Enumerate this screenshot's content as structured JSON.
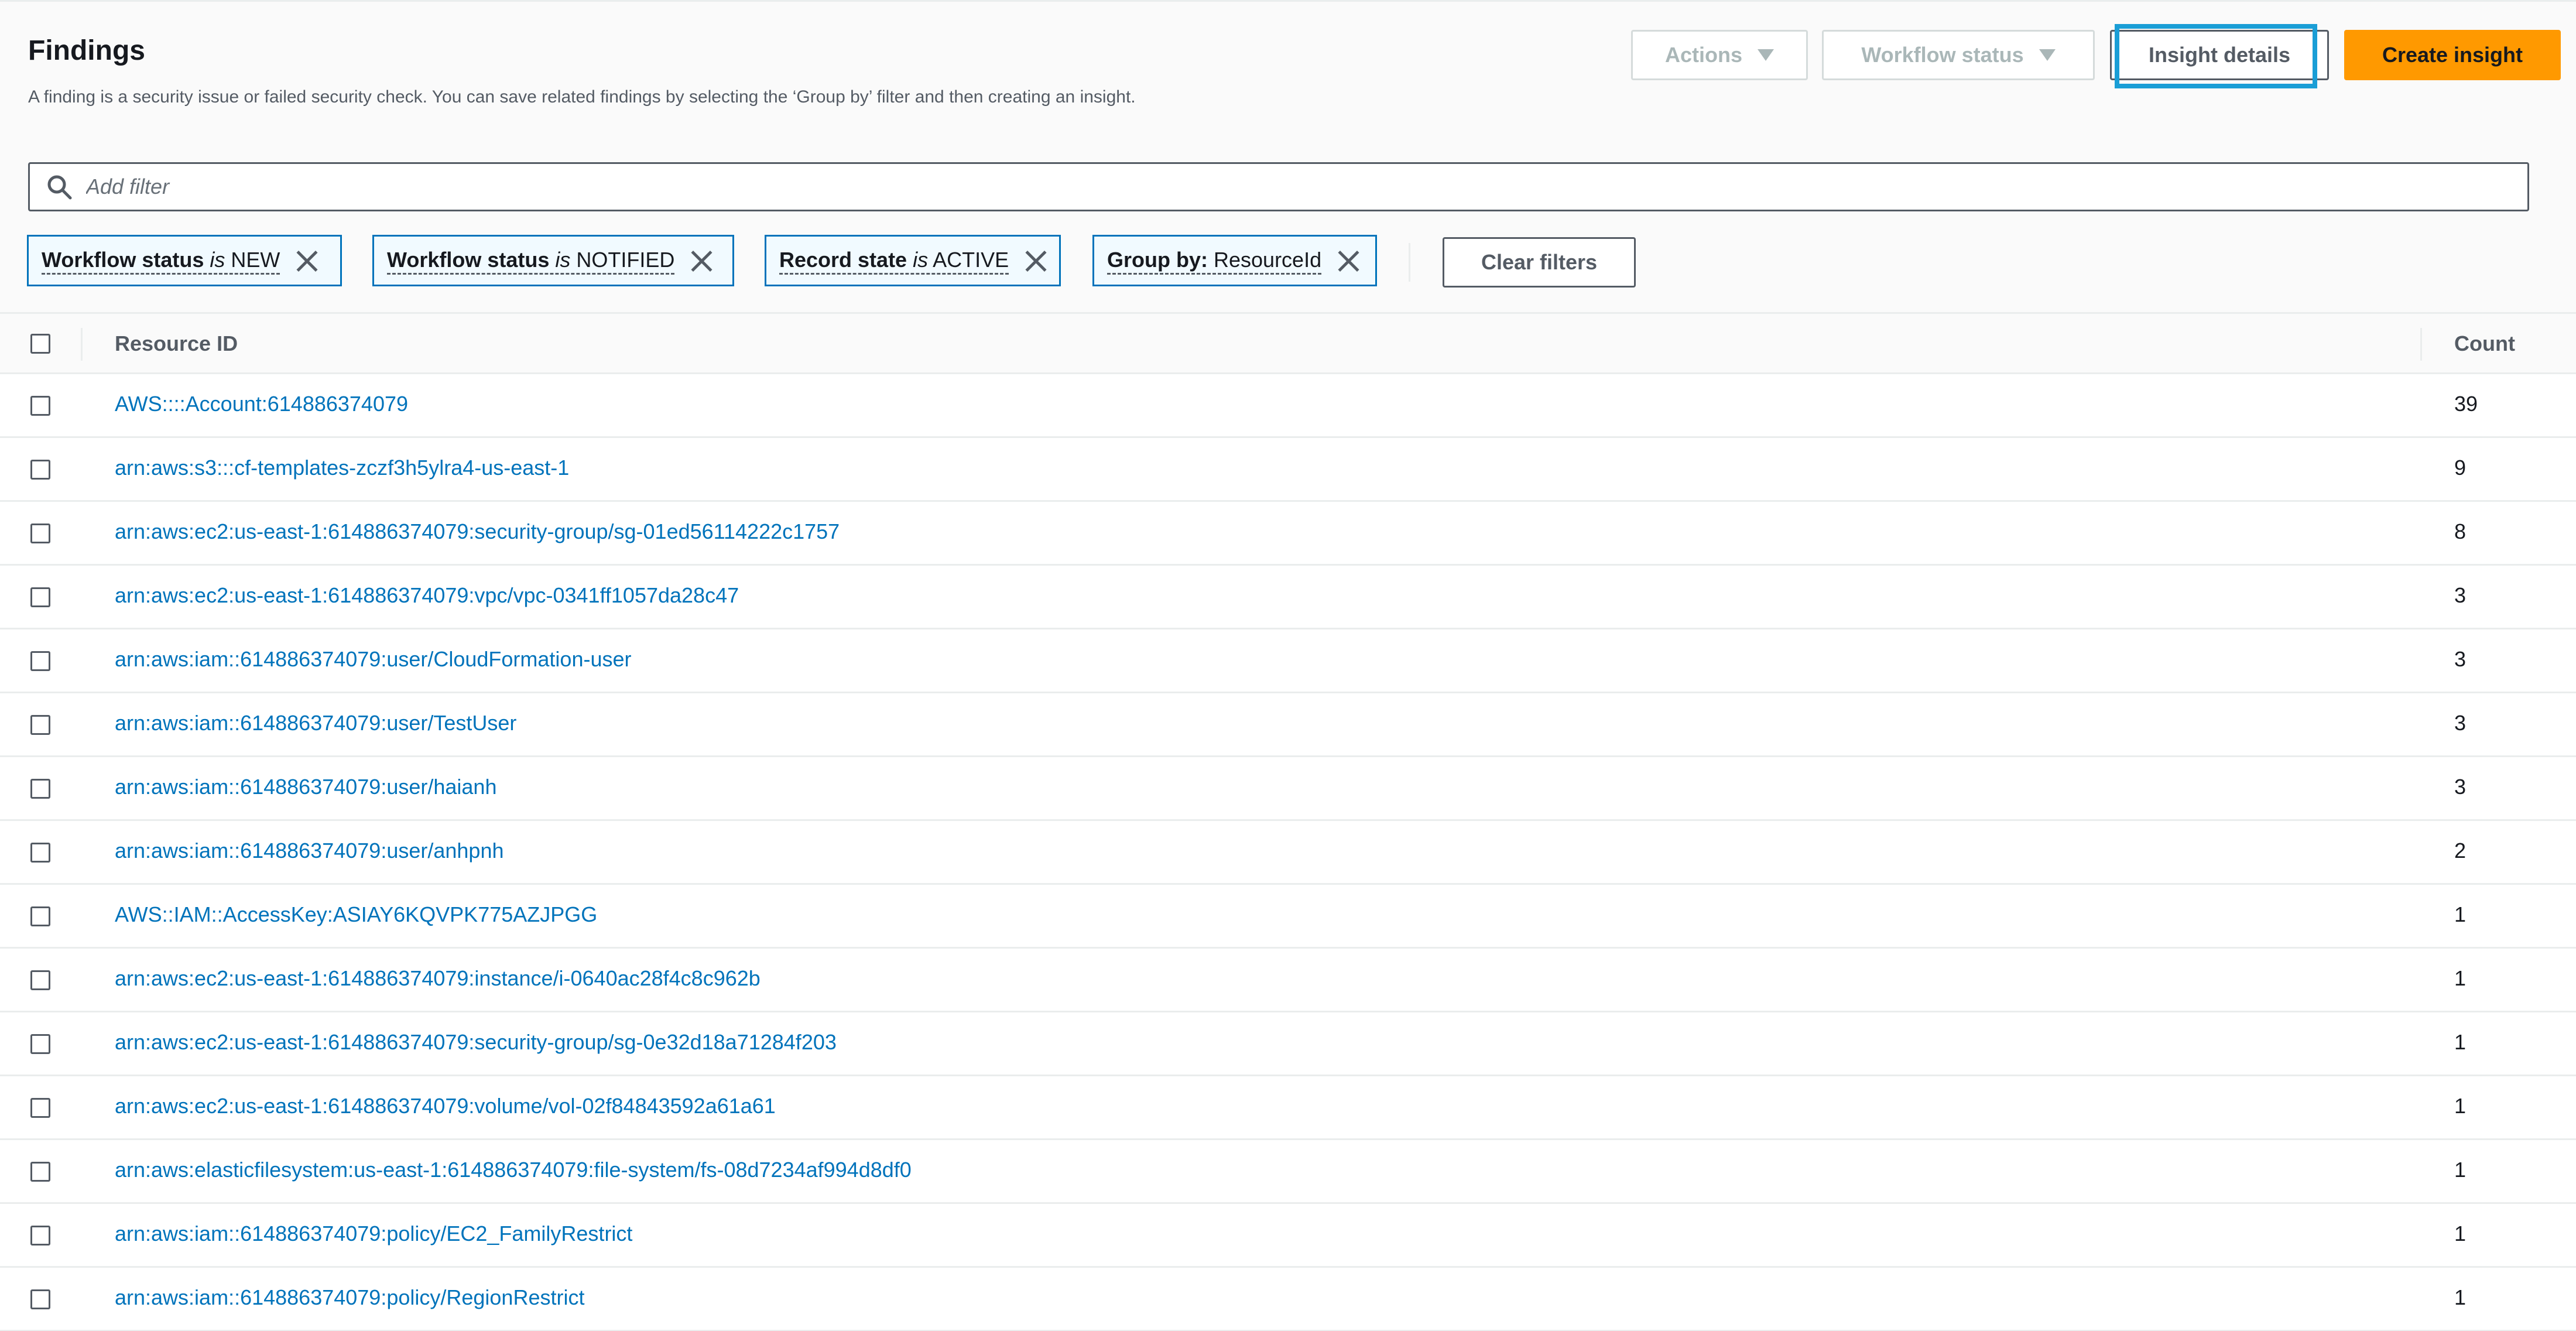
{
  "header": {
    "title": "Findings",
    "description": "A finding is a security issue or failed security check. You can save related findings by selecting the ‘Group by’ filter and then creating an insight."
  },
  "toolbar": {
    "actions_label": "Actions",
    "workflow_status_label": "Workflow status",
    "insight_details_label": "Insight details",
    "create_insight_label": "Create insight"
  },
  "filter": {
    "placeholder": "Add filter",
    "icon": "search-icon",
    "tokens": [
      {
        "key": "Workflow status",
        "op": "is",
        "value": "NEW"
      },
      {
        "key": "Workflow status",
        "op": "is",
        "value": "NOTIFIED"
      },
      {
        "key": "Record state",
        "op": "is",
        "value": "ACTIVE"
      },
      {
        "key": "Group by:",
        "op": "",
        "value": "ResourceId"
      }
    ],
    "clear_label": "Clear filters"
  },
  "table": {
    "columns": [
      "Resource ID",
      "Count"
    ],
    "rows": [
      {
        "resource": "AWS::::Account:614886374079",
        "count": "39"
      },
      {
        "resource": "arn:aws:s3:::cf-templates-zczf3h5ylra4-us-east-1",
        "count": "9"
      },
      {
        "resource": "arn:aws:ec2:us-east-1:614886374079:security-group/sg-01ed56114222c1757",
        "count": "8"
      },
      {
        "resource": "arn:aws:ec2:us-east-1:614886374079:vpc/vpc-0341ff1057da28c47",
        "count": "3"
      },
      {
        "resource": "arn:aws:iam::614886374079:user/CloudFormation-user",
        "count": "3"
      },
      {
        "resource": "arn:aws:iam::614886374079:user/TestUser",
        "count": "3"
      },
      {
        "resource": "arn:aws:iam::614886374079:user/haianh",
        "count": "3"
      },
      {
        "resource": "arn:aws:iam::614886374079:user/anhpnh",
        "count": "2"
      },
      {
        "resource": "AWS::IAM::AccessKey:ASIAY6KQVPK775AZJPGG",
        "count": "1"
      },
      {
        "resource": "arn:aws:ec2:us-east-1:614886374079:instance/i-0640ac28f4c8c962b",
        "count": "1"
      },
      {
        "resource": "arn:aws:ec2:us-east-1:614886374079:security-group/sg-0e32d18a71284f203",
        "count": "1"
      },
      {
        "resource": "arn:aws:ec2:us-east-1:614886374079:volume/vol-02f84843592a61a61",
        "count": "1"
      },
      {
        "resource": "arn:aws:elasticfilesystem:us-east-1:614886374079:file-system/fs-08d7234af994d8df0",
        "count": "1"
      },
      {
        "resource": "arn:aws:iam::614886374079:policy/EC2_FamilyRestrict",
        "count": "1"
      },
      {
        "resource": "arn:aws:iam::614886374079:policy/RegionRestrict",
        "count": "1"
      }
    ]
  },
  "colors": {
    "accent": "#ff9900",
    "link": "#0073bb",
    "highlight": "#1a9ed6"
  }
}
